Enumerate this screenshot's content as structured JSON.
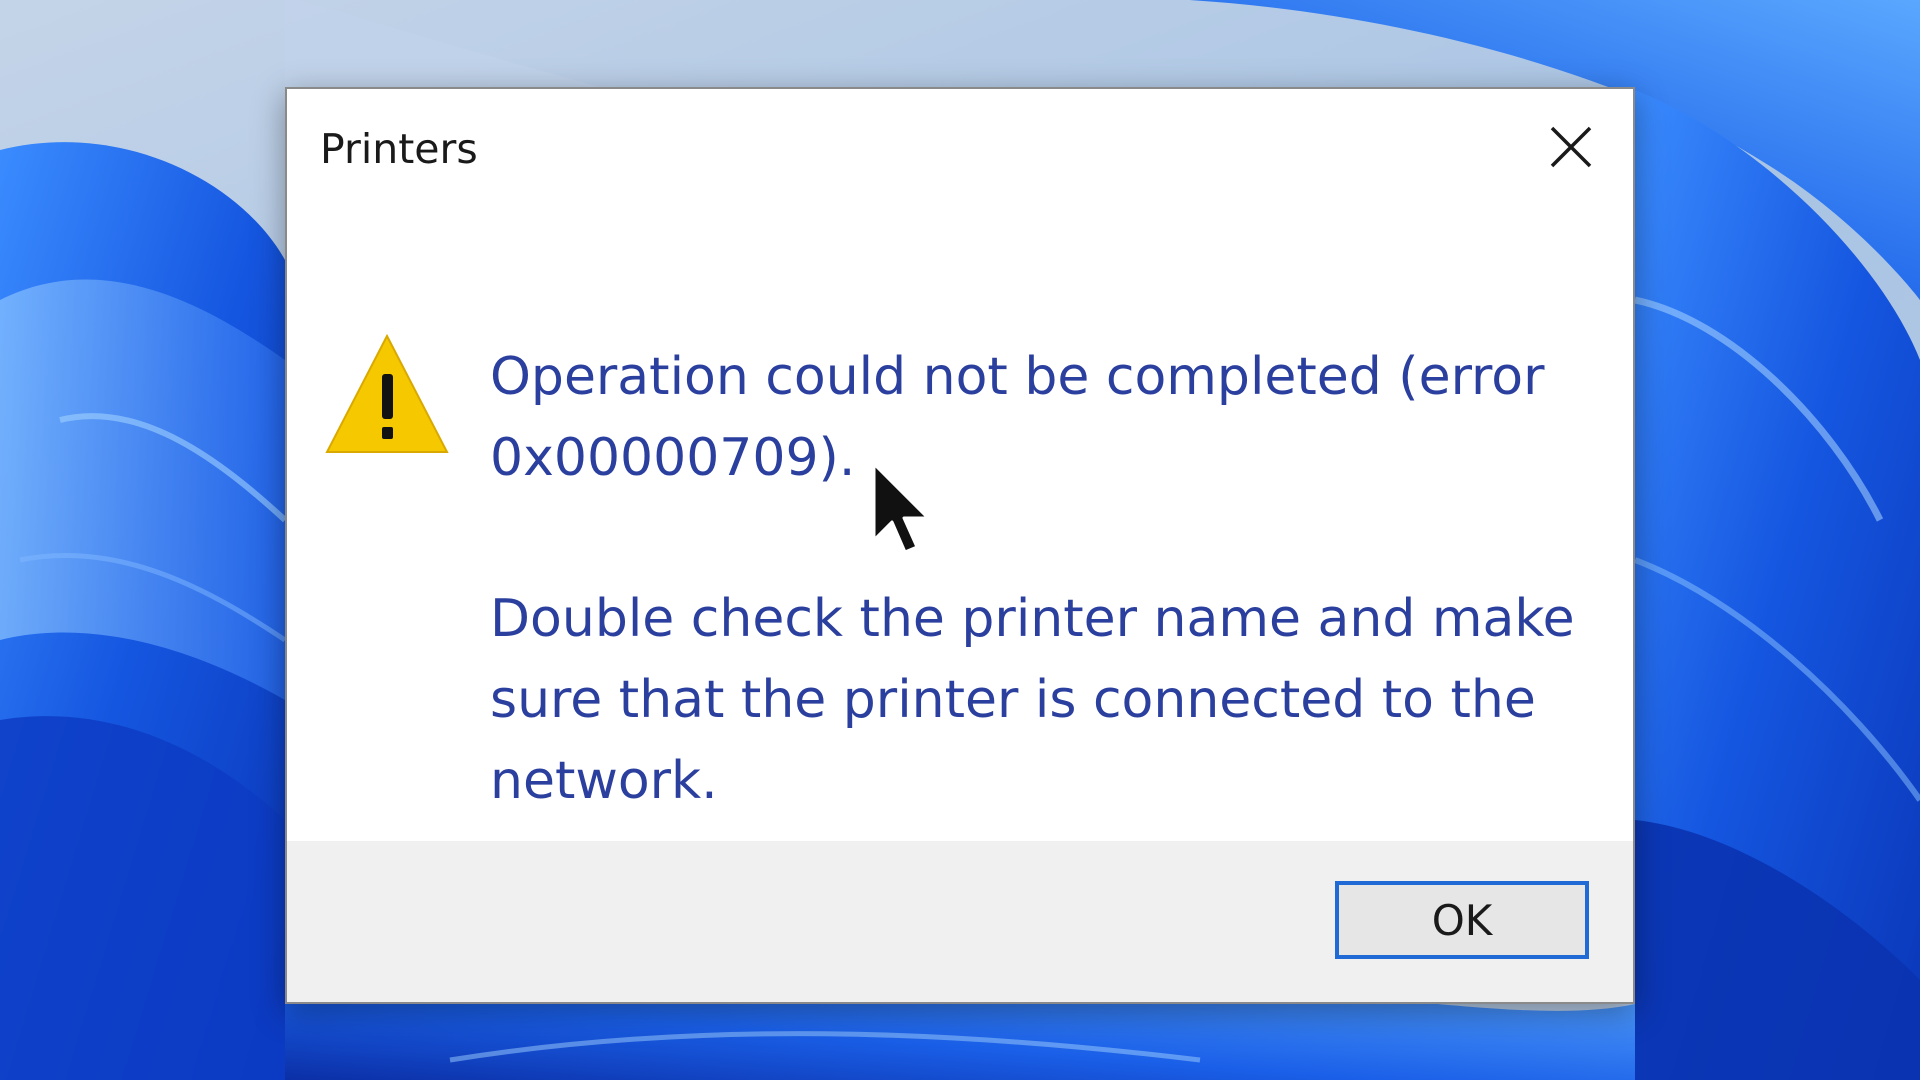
{
  "dialog": {
    "title": "Printers",
    "close_icon": "close-icon",
    "warning_icon": "warning-triangle-icon",
    "message_main": "Operation could not be completed (error 0x00000709).",
    "message_detail": "Double check the printer name and make sure that the printer is connected to the network.",
    "ok_label": "OK"
  },
  "colors": {
    "message_text": "#2a3f9e",
    "warning_fill": "#f5c800",
    "ok_border": "#1f6ad4",
    "footer_bg": "#f0f0f0",
    "wallpaper_blue": "#1f5fe0"
  }
}
